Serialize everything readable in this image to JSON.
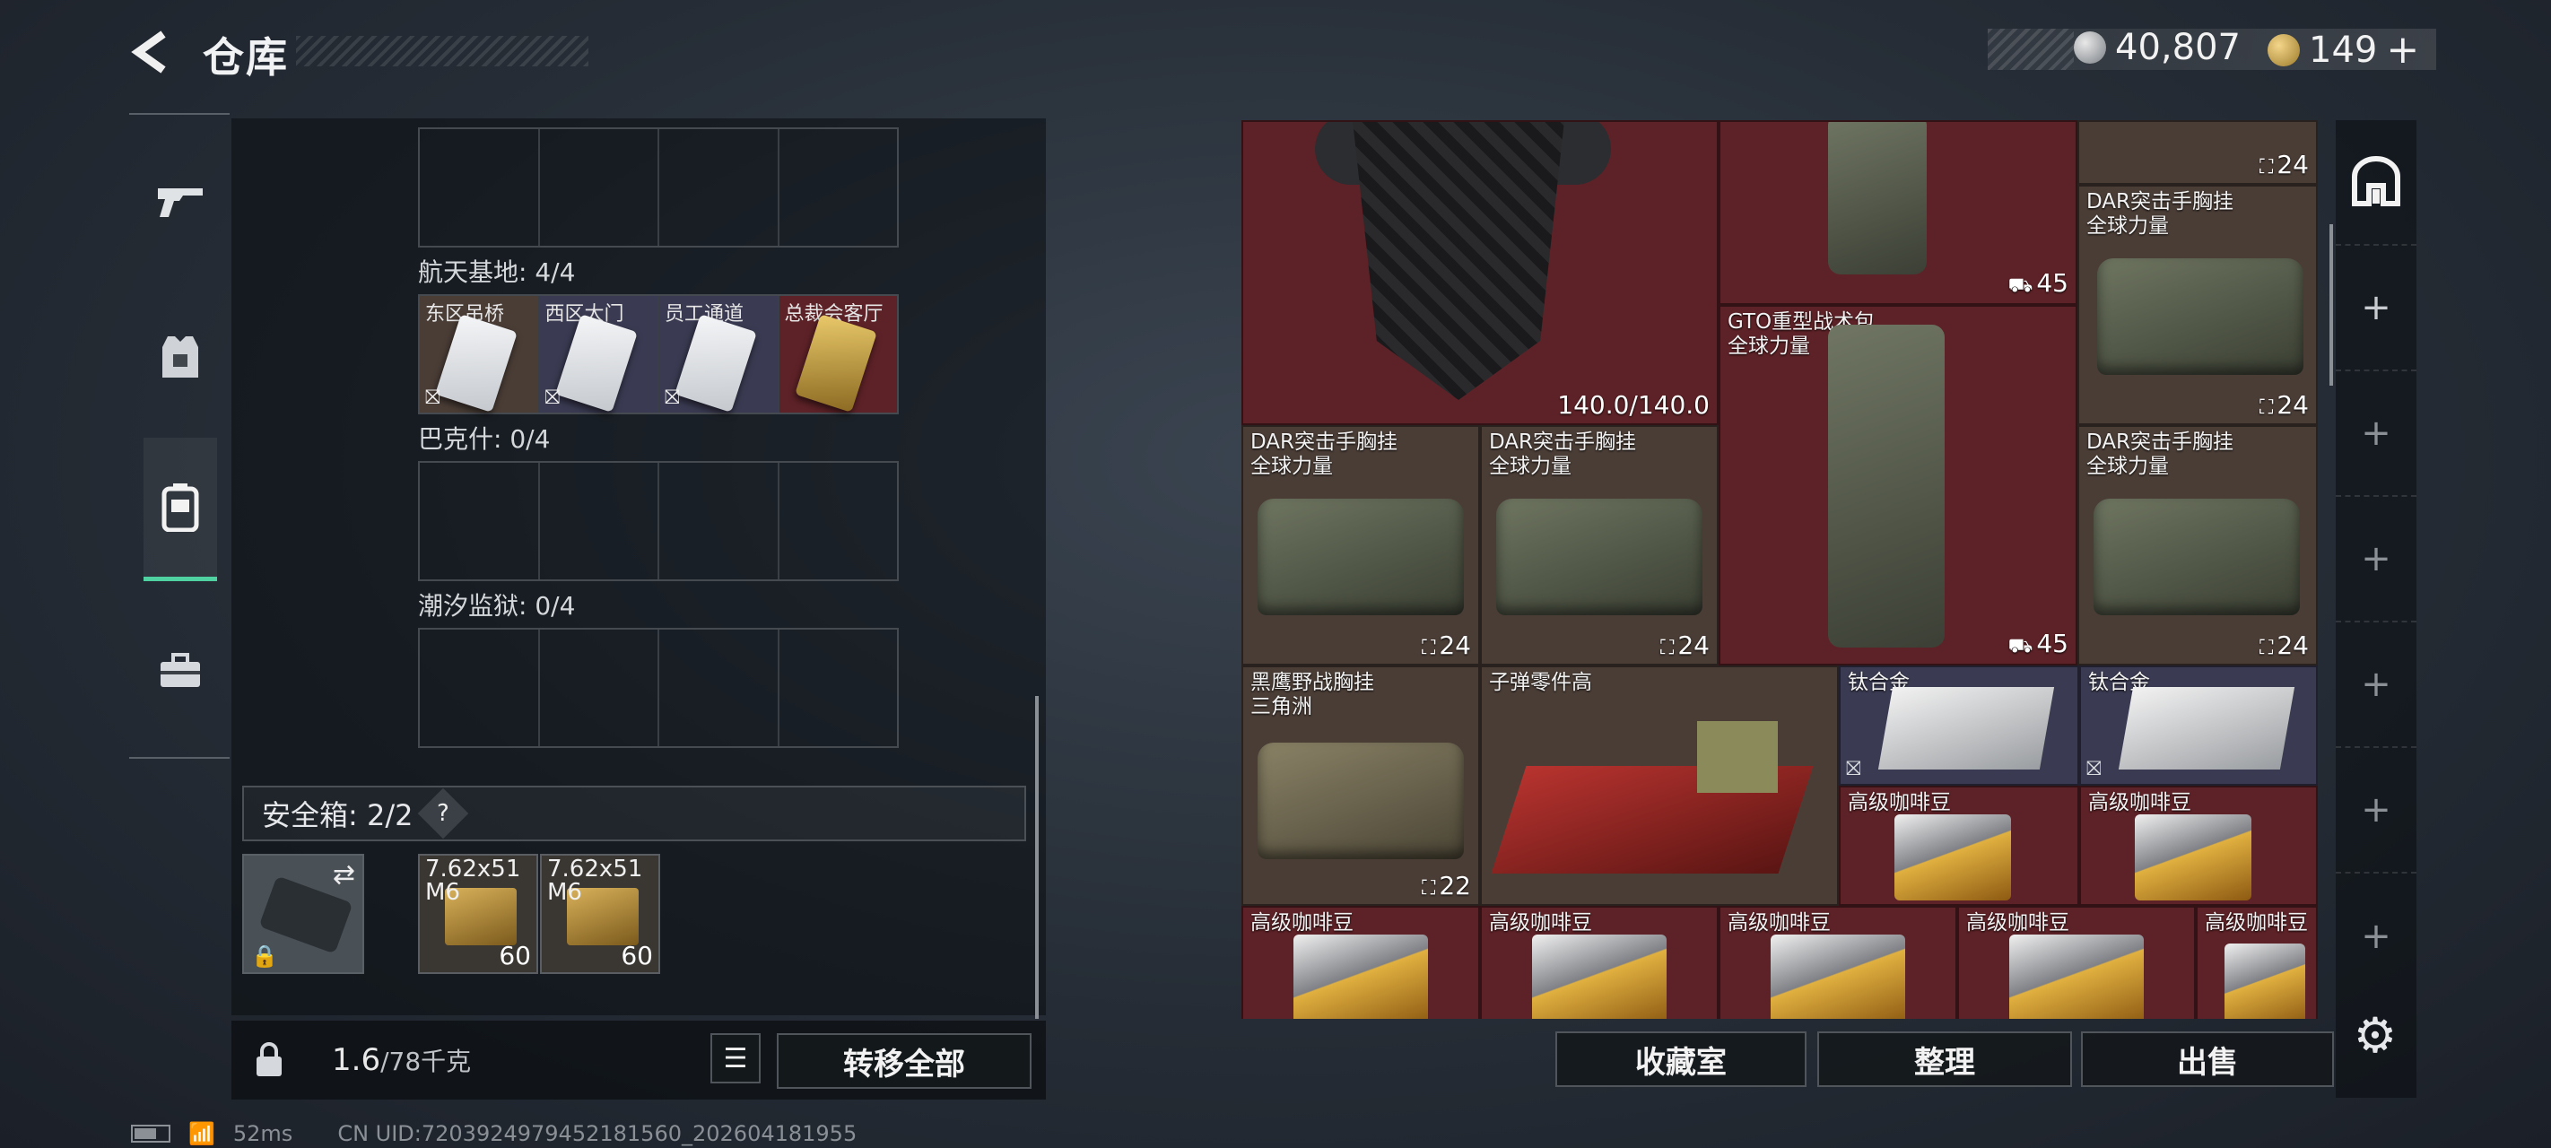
{
  "header": {
    "title": "仓库"
  },
  "currency": {
    "silver": "40,807",
    "gold": "149",
    "plus": "+"
  },
  "keys": {
    "row_spacebase_label": "航天基地: 4/4",
    "cards": [
      {
        "name": "东区吊桥",
        "style": "white"
      },
      {
        "name": "西区大门",
        "style": "white"
      },
      {
        "name": "员工通道",
        "style": "white"
      },
      {
        "name": "总裁会客厅",
        "style": "gold"
      }
    ],
    "bakesh_label": "巴克什: 0/4",
    "tide_label": "潮汐监狱: 0/4"
  },
  "safe": {
    "label": "安全箱: 2/2",
    "help": "?",
    "ammo": [
      {
        "name": "7.62x51 M6",
        "count": "60"
      },
      {
        "name": "7.62x51 M6",
        "count": "60"
      }
    ]
  },
  "footer_left": {
    "weight_value": "1.6",
    "weight_max": "/78千克",
    "transfer_all": "转移全部"
  },
  "grid": {
    "armor_durability": "140.0/140.0",
    "items": [
      {
        "id": "top-right-24",
        "count": "24"
      },
      {
        "id": "backpack-top",
        "count": "45"
      },
      {
        "id": "dar-top-right",
        "name1": "DAR突击手胸挂",
        "name2": "全球力量",
        "count": "24"
      },
      {
        "id": "gto",
        "name1": "GTO重型战术包",
        "name2": "全球力量",
        "count": "45"
      },
      {
        "id": "dar-1",
        "name1": "DAR突击手胸挂",
        "name2": "全球力量",
        "count": "24"
      },
      {
        "id": "dar-2",
        "name1": "DAR突击手胸挂",
        "name2": "全球力量",
        "count": "24"
      },
      {
        "id": "dar-3",
        "name1": "DAR突击手胸挂",
        "name2": "全球力量",
        "count": "24"
      },
      {
        "id": "blackhawk",
        "name1": "黑鹰野战胸挂",
        "name2": "三角洲",
        "count": "22"
      },
      {
        "id": "bullet-parts",
        "name1": "子弹零件高"
      },
      {
        "id": "ti-1",
        "name1": "钛合金"
      },
      {
        "id": "ti-2",
        "name1": "钛合金"
      },
      {
        "id": "coffee-1",
        "name1": "高级咖啡豆"
      },
      {
        "id": "coffee-2",
        "name1": "高级咖啡豆"
      },
      {
        "id": "coffee-3",
        "name1": "高级咖啡豆"
      },
      {
        "id": "coffee-4",
        "name1": "高级咖啡豆"
      },
      {
        "id": "coffee-5",
        "name1": "高级咖啡豆"
      },
      {
        "id": "coffee-6",
        "name1": "高级咖啡豆"
      },
      {
        "id": "coffee-7",
        "name1": "高级咖啡豆"
      }
    ]
  },
  "footer_right": {
    "collection": "收藏室",
    "organize": "整理",
    "sell": "出售"
  },
  "status": {
    "ping": "52ms",
    "uid": "CN UID:7203924979452181560_202604181955"
  }
}
